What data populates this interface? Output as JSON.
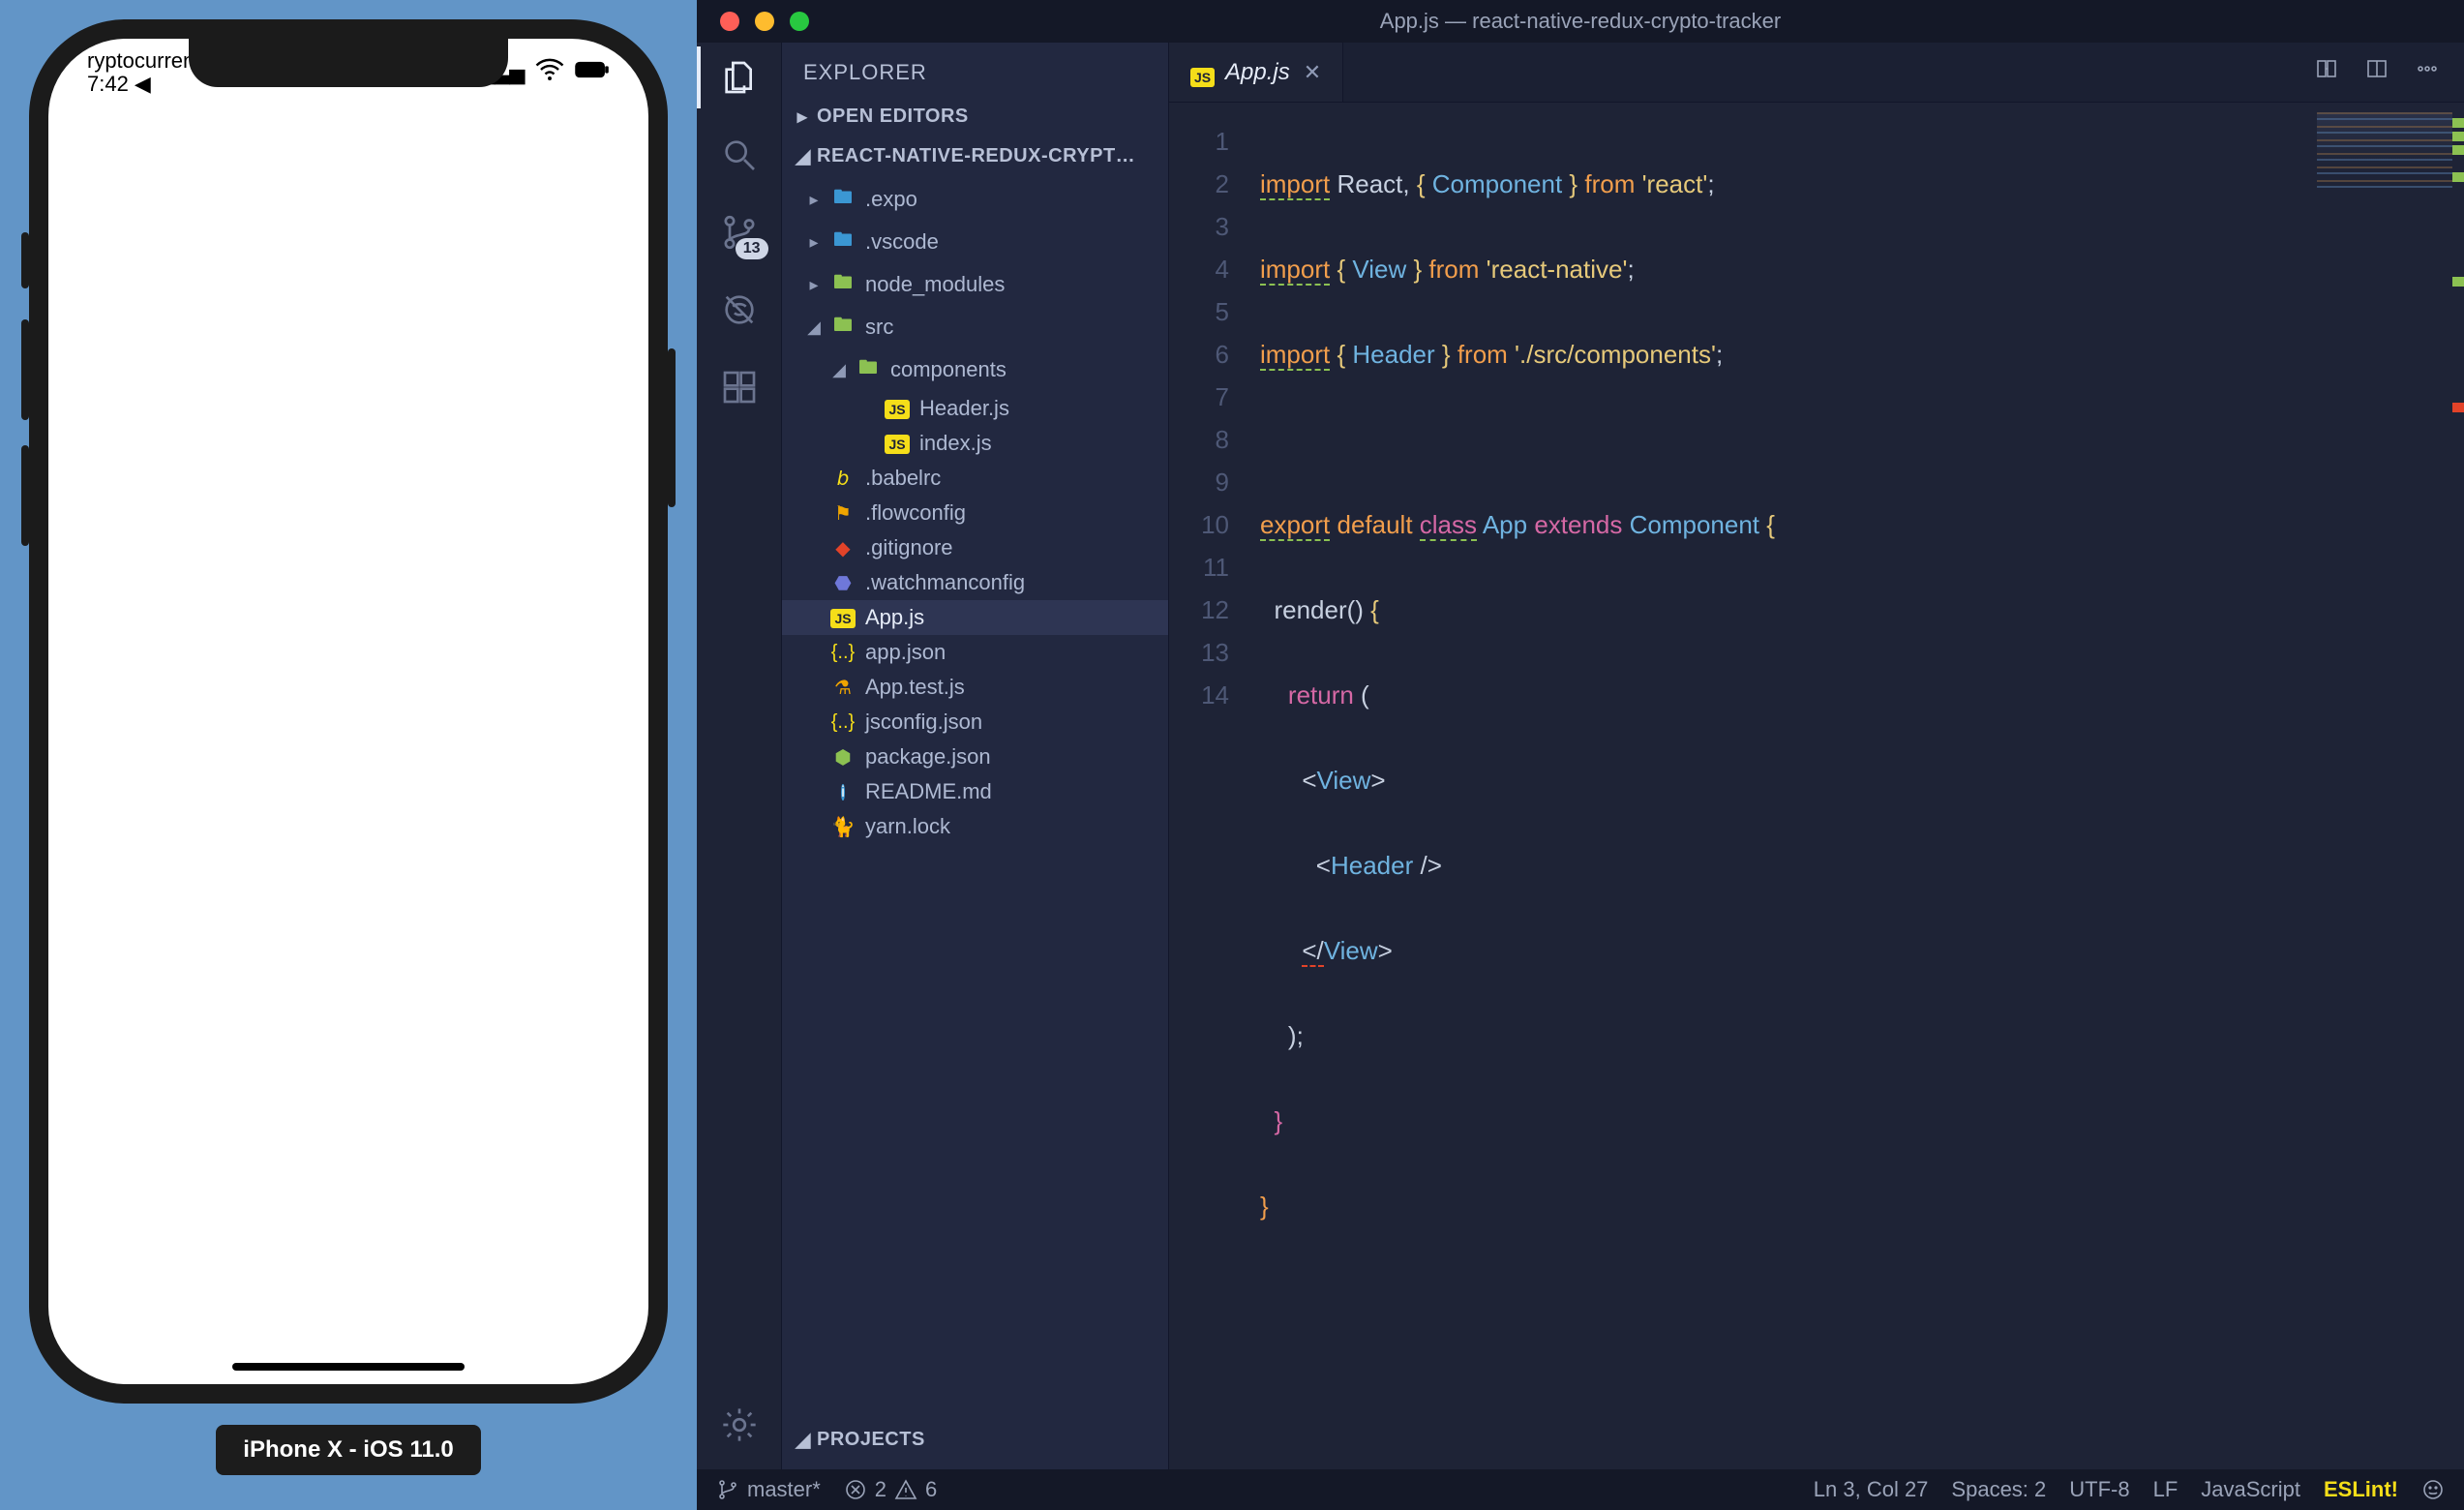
{
  "simulator": {
    "status_left_top": "ryptocurren",
    "status_time": "7:42 ◀",
    "device_label": "iPhone X - iOS 11.0"
  },
  "window": {
    "title": "App.js — react-native-redux-crypto-tracker"
  },
  "activitybar": {
    "scm_badge": "13"
  },
  "sidebar": {
    "title": "EXPLORER",
    "sections": {
      "open_editors": "OPEN EDITORS",
      "project_name": "REACT-NATIVE-REDUX-CRYPT…",
      "projects": "PROJECTS"
    },
    "tree": {
      "expo": ".expo",
      "vscode": ".vscode",
      "node_modules": "node_modules",
      "src": "src",
      "components": "components",
      "header_js": "Header.js",
      "index_js": "index.js",
      "babelrc": ".babelrc",
      "flowconfig": ".flowconfig",
      "gitignore": ".gitignore",
      "watchmanconfig": ".watchmanconfig",
      "app_js": "App.js",
      "app_json": "app.json",
      "app_test_js": "App.test.js",
      "jsconfig_json": "jsconfig.json",
      "package_json": "package.json",
      "readme_md": "README.md",
      "yarn_lock": "yarn.lock"
    }
  },
  "tabs": {
    "active": "App.js"
  },
  "editor": {
    "lines": [
      "1",
      "2",
      "3",
      "4",
      "5",
      "6",
      "7",
      "8",
      "9",
      "10",
      "11",
      "12",
      "13",
      "14"
    ],
    "code": {
      "l1": {
        "import": "import",
        "react": "React",
        "comma": ", ",
        "lbrace": "{ ",
        "component": "Component",
        "rbrace": " }",
        "from": " from ",
        "str": "'react'",
        "semi": ";"
      },
      "l2": {
        "import": "import",
        "lbrace": " { ",
        "view": "View",
        "rbrace": " }",
        "from": " from ",
        "str": "'react-native'",
        "semi": ";"
      },
      "l3": {
        "import": "import",
        "lbrace": " { ",
        "header": "Header",
        "rbrace": " }",
        "from": " from ",
        "str": "'./src/components'",
        "semi": ";"
      },
      "l5": {
        "export": "export",
        "default": " default ",
        "class": "class",
        "app": " App ",
        "extends": "extends",
        "component": " Component ",
        "brace": "{"
      },
      "l6": {
        "indent": "  ",
        "render": "render",
        "parens": "() ",
        "brace": "{"
      },
      "l7": {
        "indent": "    ",
        "return": "return",
        "paren": " ("
      },
      "l8": {
        "indent": "      ",
        "lt": "<",
        "view": "View",
        "gt": ">"
      },
      "l9": {
        "indent": "        ",
        "lt": "<",
        "header": "Header",
        "slash": " /",
        "gt": ">"
      },
      "l10": {
        "indent": "      ",
        "lt": "</",
        "view": "View",
        "gt": ">"
      },
      "l11": {
        "indent": "    ",
        "paren": ")",
        "semi": ";"
      },
      "l12": {
        "indent": "  ",
        "brace": "}"
      },
      "l13": {
        "brace": "}"
      }
    }
  },
  "statusbar": {
    "branch": "master*",
    "errors": "2",
    "warnings": "6",
    "ln_col": "Ln 3, Col 27",
    "spaces": "Spaces: 2",
    "encoding": "UTF-8",
    "eol": "LF",
    "language": "JavaScript",
    "eslint": "ESLint!"
  }
}
